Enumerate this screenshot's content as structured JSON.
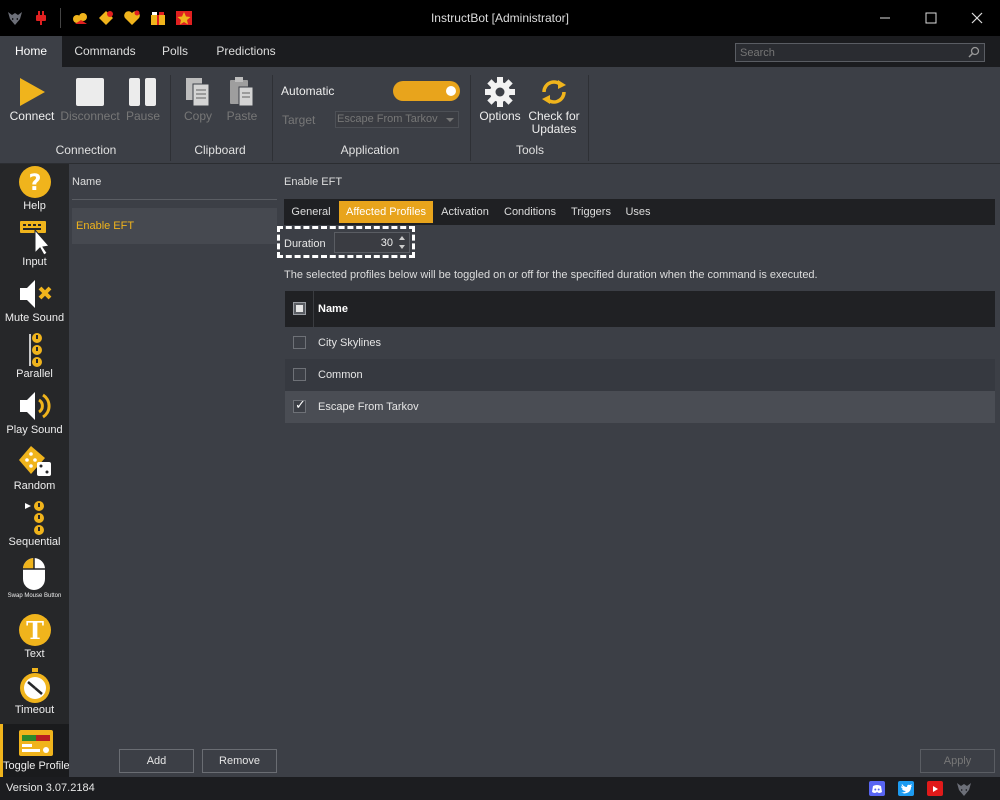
{
  "window": {
    "title": "InstructBot [Administrator]",
    "title_icons": [
      "wolf-logo-icon",
      "plug-icon",
      "donation-icon",
      "sub-icon",
      "heart-icon",
      "gift-icon",
      "star-icon"
    ]
  },
  "menu": {
    "tabs": [
      {
        "label": "Home",
        "active": true
      },
      {
        "label": "Commands",
        "active": false
      },
      {
        "label": "Polls",
        "active": false
      },
      {
        "label": "Predictions",
        "active": false
      }
    ],
    "search_placeholder": "Search"
  },
  "ribbon": {
    "connect": "Connect",
    "disconnect": "Disconnect",
    "pause": "Pause",
    "copy": "Copy",
    "paste": "Paste",
    "automatic_label": "Automatic",
    "automatic_on": true,
    "target_label": "Target",
    "target_value": "Escape From Tarkov",
    "options": "Options",
    "check_updates": "Check for Updates",
    "groups": {
      "connection": "Connection",
      "clipboard": "Clipboard",
      "application": "Application",
      "tools": "Tools"
    }
  },
  "actions": [
    {
      "label": "Help"
    },
    {
      "label": "Input"
    },
    {
      "label": "Mute Sound"
    },
    {
      "label": "Parallel"
    },
    {
      "label": "Play Sound"
    },
    {
      "label": "Random"
    },
    {
      "label": "Sequential"
    },
    {
      "label": "Swap Mouse Button"
    },
    {
      "label": "Text"
    },
    {
      "label": "Timeout"
    },
    {
      "label": "Toggle Profile"
    }
  ],
  "list": {
    "header": "Name",
    "items": [
      "Enable EFT"
    ],
    "add": "Add",
    "remove": "Remove"
  },
  "detail": {
    "title": "Enable EFT",
    "tabs": [
      {
        "label": "General",
        "active": false
      },
      {
        "label": "Affected Profiles",
        "active": true
      },
      {
        "label": "Activation",
        "active": false
      },
      {
        "label": "Conditions",
        "active": false
      },
      {
        "label": "Triggers",
        "active": false
      },
      {
        "label": "Uses",
        "active": false
      }
    ],
    "duration_label": "Duration",
    "duration_value": "30",
    "description": "The selected profiles below will be toggled on or off for the specified duration when the command is executed.",
    "grid_header": "Name",
    "profiles": [
      {
        "name": "City Skylines",
        "checked": false
      },
      {
        "name": "Common",
        "checked": false
      },
      {
        "name": "Escape From Tarkov",
        "checked": true
      }
    ],
    "apply": "Apply"
  },
  "status": {
    "version": "Version 3.07.2184",
    "social": [
      "discord-icon",
      "twitter-icon",
      "youtube-icon",
      "wolf-logo-icon"
    ]
  },
  "colors": {
    "accent": "#e8a41c",
    "background": "#3c3f46",
    "titlebar": "#000000"
  }
}
